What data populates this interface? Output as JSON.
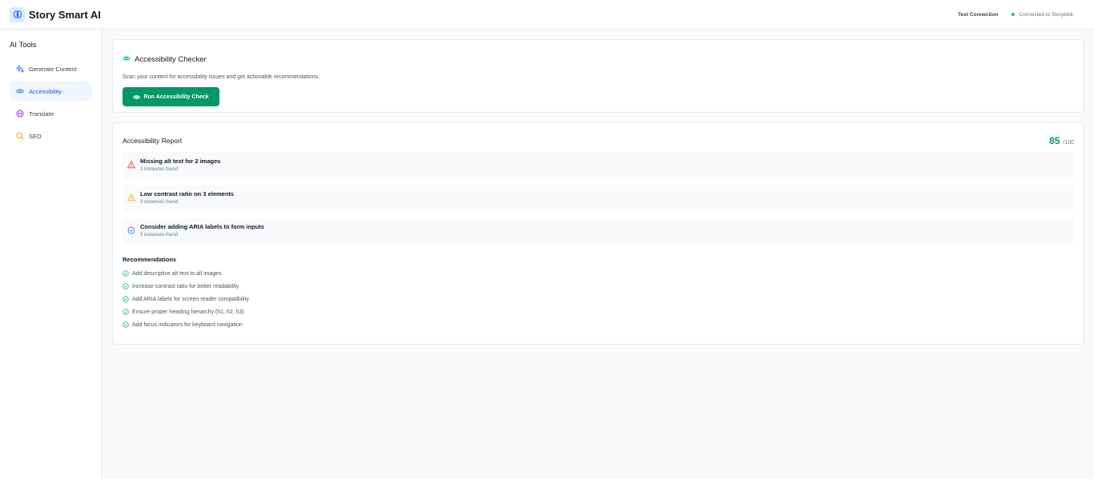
{
  "header": {
    "app_title": "Story Smart AI",
    "test_connection": "Test Connection",
    "status": "Connected to Storyblok",
    "logo_icon": "brain-icon"
  },
  "sidebar": {
    "title": "AI Tools",
    "items": [
      {
        "label": "Generate Content",
        "icon": "sparkles-icon",
        "active": false
      },
      {
        "label": "Accessibility",
        "icon": "eye-icon",
        "active": true
      },
      {
        "label": "Translate",
        "icon": "globe-icon",
        "active": false
      },
      {
        "label": "SEO",
        "icon": "search-icon",
        "active": false
      }
    ]
  },
  "checker": {
    "title": "Accessibility Checker",
    "description": "Scan your content for accessibility issues and get actionable recommendations.",
    "button": "Run Accessibility Check"
  },
  "report": {
    "title": "Accessibility Report",
    "score": "85",
    "score_max": "/100",
    "issues": [
      {
        "title": "Missing alt text for 2 images",
        "sub": "2 instances found",
        "icon": "alert-triangle-icon",
        "color": "#ef4444"
      },
      {
        "title": "Low contrast ratio on 3 elements",
        "sub": "3 instances found",
        "icon": "alert-triangle-icon",
        "color": "#eab308"
      },
      {
        "title": "Consider adding ARIA labels to form inputs",
        "sub": "5 instances found",
        "icon": "check-circle-icon",
        "color": "#3b82f6"
      }
    ],
    "recommendations_title": "Recommendations",
    "recommendations": [
      "Add descriptive alt text to all images",
      "Increase contrast ratio for better readability",
      "Add ARIA labels for screen reader compatibility",
      "Ensure proper heading hierarchy (h1, h2, h3)",
      "Add focus indicators for keyboard navigation"
    ]
  },
  "colors": {
    "accent_green": "#059669",
    "active_blue": "#1d4ed8",
    "status_green": "#22c55e"
  }
}
